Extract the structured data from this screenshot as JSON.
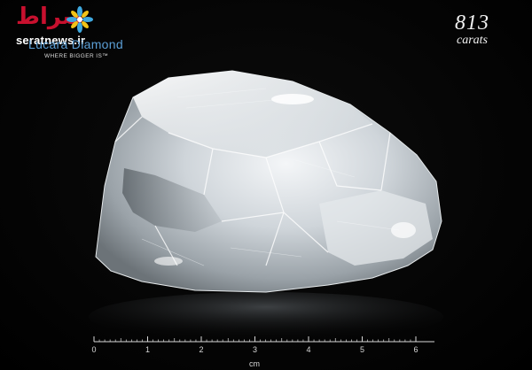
{
  "watermark": {
    "persian": "صراط",
    "site": "seratnews.ir",
    "brand": "Lucara Diamond",
    "tagline": "WHERE BIGGER IS™"
  },
  "weight": {
    "value": "813",
    "unit": "carats"
  },
  "scale": {
    "ticks": [
      "0",
      "1",
      "2",
      "3",
      "4",
      "5",
      "6"
    ],
    "unit": "cm"
  },
  "colors": {
    "background": "#000000",
    "brand_blue": "#5b9fd6",
    "watermark_red": "#c8102e"
  }
}
